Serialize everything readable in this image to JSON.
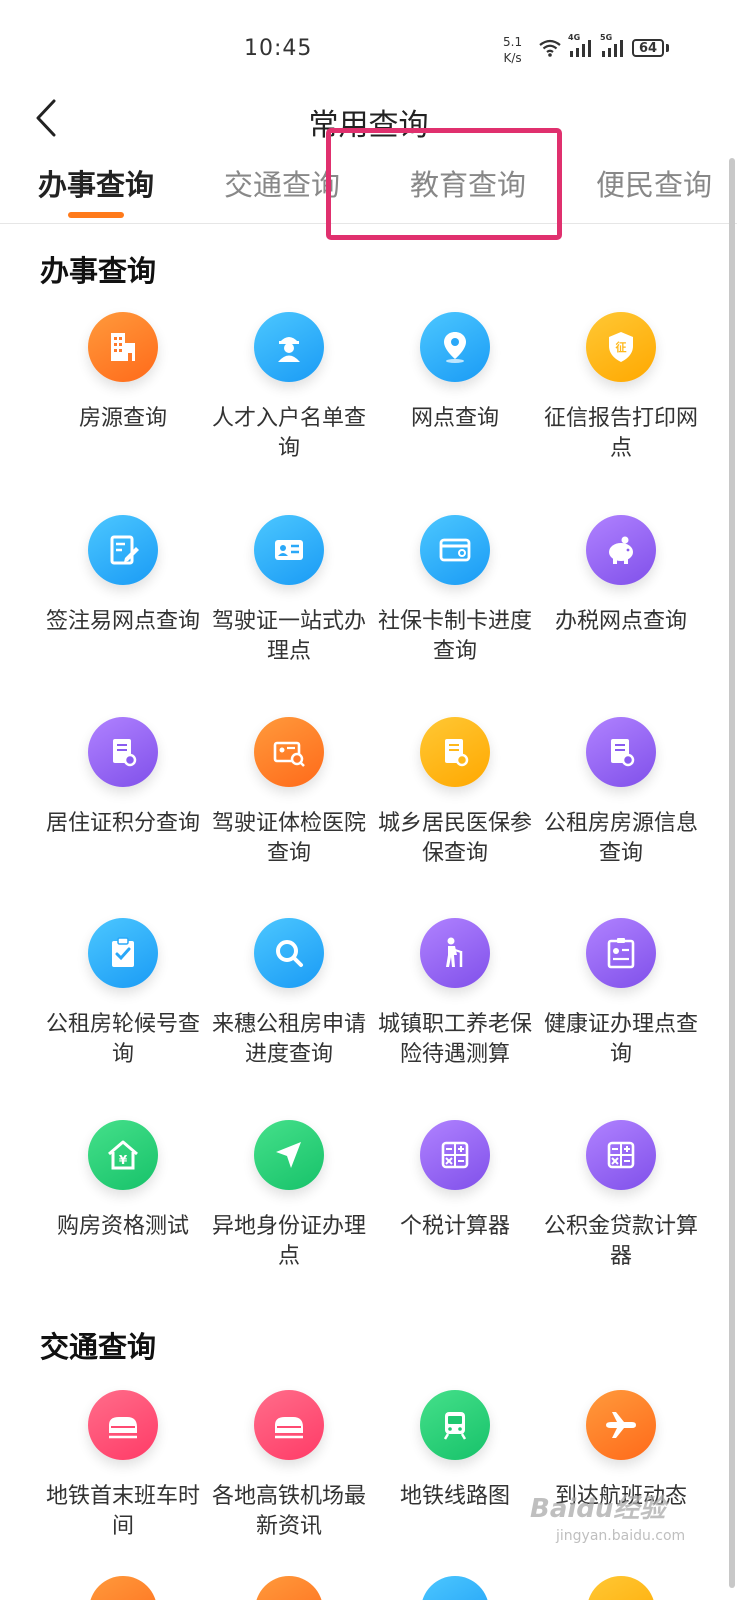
{
  "status_bar": {
    "time": "10:45",
    "speed": "5.1",
    "speed_unit": "K/s",
    "battery": "64",
    "net1": "4G",
    "net2": "5G"
  },
  "nav": {
    "title": "常用查询"
  },
  "tabs": [
    {
      "label": "办事查询"
    },
    {
      "label": "交通查询"
    },
    {
      "label": "教育查询"
    },
    {
      "label": "便民查询"
    }
  ],
  "sections": [
    {
      "title": "办事查询",
      "items": [
        {
          "label": "房源查询",
          "icon": "building-icon",
          "color": "#ff7a2a"
        },
        {
          "label": "人才入户名单查询",
          "icon": "worker-icon",
          "color": "#2aa8f8"
        },
        {
          "label": "网点查询",
          "icon": "location-pin-icon",
          "color": "#2aa8f8"
        },
        {
          "label": "征信报告打印网点",
          "icon": "credit-shield-icon",
          "color": "#ffb81a"
        },
        {
          "label": "签注易网点查询",
          "icon": "edit-document-icon",
          "color": "#2aa8f8"
        },
        {
          "label": "驾驶证一站式办理点",
          "icon": "id-card-icon",
          "color": "#2aa8f8"
        },
        {
          "label": "社保卡制卡进度查询",
          "icon": "bank-card-icon",
          "color": "#2aa8f8"
        },
        {
          "label": "办税网点查询",
          "icon": "piggy-bank-icon",
          "color": "#8a5cf0"
        },
        {
          "label": "居住证积分查询",
          "icon": "document-search-icon",
          "color": "#8a5cf0"
        },
        {
          "label": "驾驶证体检医院查询",
          "icon": "license-search-icon",
          "color": "#ff7a2a"
        },
        {
          "label": "城乡居民医保参保查询",
          "icon": "document-search-icon",
          "color": "#ffb81a"
        },
        {
          "label": "公租房房源信息查询",
          "icon": "document-search-icon",
          "color": "#8a5cf0"
        },
        {
          "label": "公租房轮候号查询",
          "icon": "clipboard-check-icon",
          "color": "#2aa8f8"
        },
        {
          "label": "来穗公租房申请进度查询",
          "icon": "search-icon",
          "color": "#2aa8f8"
        },
        {
          "label": "城镇职工养老保险待遇测算",
          "icon": "elderly-icon",
          "color": "#8a5cf0"
        },
        {
          "label": "健康证办理点查询",
          "icon": "health-card-icon",
          "color": "#8a5cf0"
        },
        {
          "label": "购房资格测试",
          "icon": "house-yuan-icon",
          "color": "#1fc870"
        },
        {
          "label": "异地身份证办理点",
          "icon": "send-arrow-icon",
          "color": "#1fc870"
        },
        {
          "label": "个税计算器",
          "icon": "calculator-icon",
          "color": "#8a5cf0"
        },
        {
          "label": "公积金贷款计算器",
          "icon": "calculator-icon",
          "color": "#8a5cf0"
        }
      ]
    },
    {
      "title": "交通查询",
      "items": [
        {
          "label": "地铁首末班车时间",
          "icon": "train-icon",
          "color": "#ff4a72"
        },
        {
          "label": "各地高铁机场最新资讯",
          "icon": "train-icon",
          "color": "#ff4a72"
        },
        {
          "label": "地铁线路图",
          "icon": "metro-icon",
          "color": "#1fc870"
        },
        {
          "label": "到达航班动态",
          "icon": "airplane-icon",
          "color": "#ff7a2a"
        }
      ]
    }
  ],
  "watermark": {
    "brand": "Baidu经验",
    "site": "jingyan.baidu.com"
  }
}
